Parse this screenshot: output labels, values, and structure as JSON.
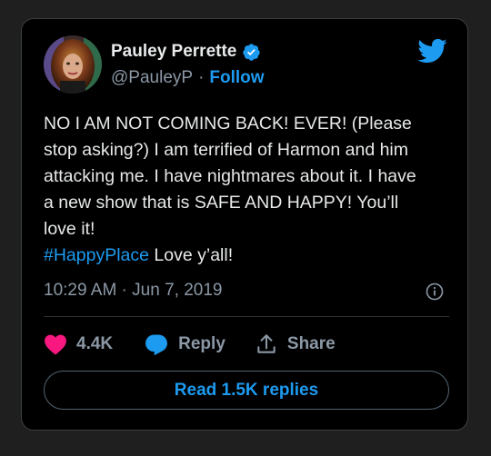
{
  "author": {
    "name": "Pauley Perrette",
    "handle": "@PauleyP",
    "separator": "·",
    "follow_label": "Follow"
  },
  "tweet": {
    "lines": [
      "NO I AM NOT COMING BACK! EVER!  (Please",
      "stop asking?) I am terrified of Harmon and him",
      "attacking me. I have nightmares about it. I have",
      "a new show that is SAFE AND HAPPY! You’ll",
      "love it!"
    ],
    "hashtag": "#HappyPlace",
    "after_hashtag": " Love y’all!",
    "timestamp": "10:29 AM · Jun 7, 2019"
  },
  "actions": {
    "like_count": "4.4K",
    "reply_label": "Reply",
    "share_label": "Share"
  },
  "read_replies_label": "Read 1.5K replies",
  "colors": {
    "accent": "#1d9bf0",
    "like": "#f91880",
    "verified": "#1d9bf0",
    "background": "#000000"
  },
  "icons": {
    "verified": "verified-badge-icon",
    "logo": "twitter-bird-icon",
    "info": "info-icon",
    "like": "heart-icon",
    "reply": "speech-bubble-icon",
    "share": "share-upload-icon"
  }
}
